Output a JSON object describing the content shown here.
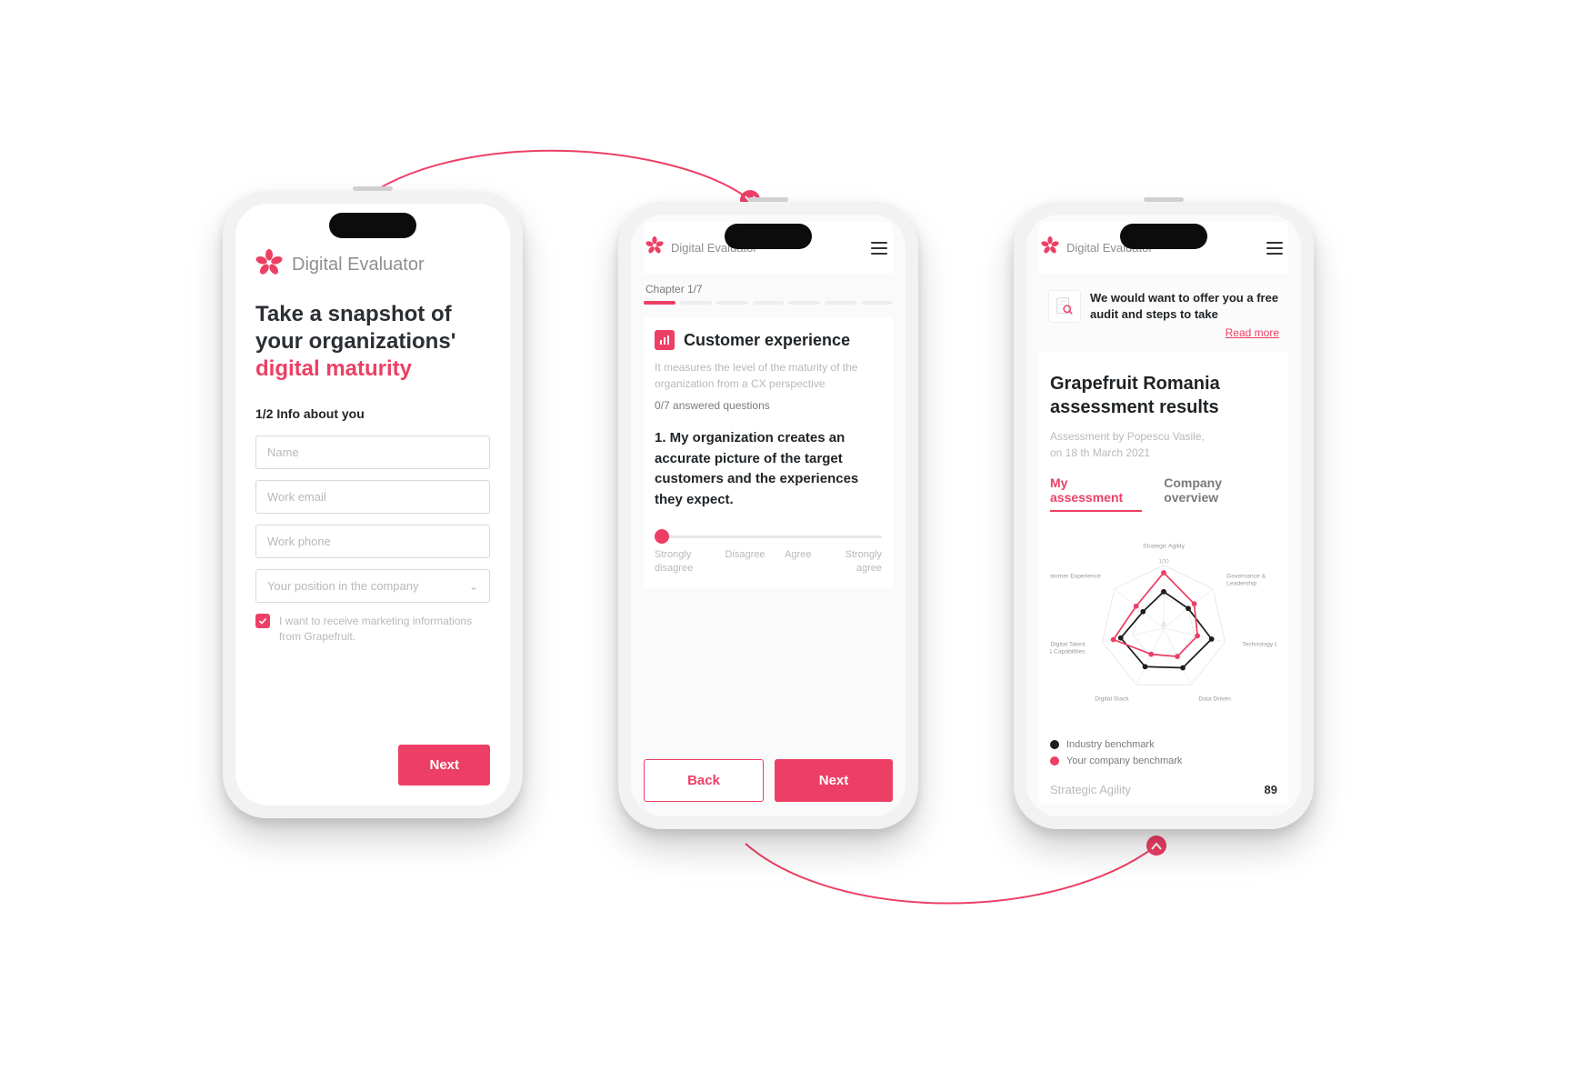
{
  "brand_name": "Digital Evaluator",
  "phone1": {
    "headline_a": "Take a snapshot of your organizations' ",
    "headline_b": "digital maturity",
    "step": "1/2 Info about you",
    "fields": {
      "name": "Name",
      "email": "Work email",
      "phone": "Work phone",
      "position": "Your position in the company"
    },
    "optin": "I want to receive marketing informations from Grapefruit.",
    "next": "Next"
  },
  "phone2": {
    "chapter_label": "Chapter 1/7",
    "title": "Customer experience",
    "desc": "It measures the level of the maturity of the organization from a CX perspective",
    "answered": "0/7 answered questions",
    "question": "1. My organization creates an accurate picture of the target customers and the experiences they expect.",
    "scale": [
      "Strongly disagree",
      "Disagree",
      "Agree",
      "Strongly agree"
    ],
    "back": "Back",
    "next": "Next"
  },
  "phone3": {
    "banner_text": "We would want to offer you a free audit and steps to take",
    "banner_link": "Read more",
    "title": "Grapefruit Romania assessment results",
    "byline1": "Assessment by Popescu Vasile,",
    "byline2": "on 18 th March 2021",
    "tab1": "My assessment",
    "tab2": "Company overview",
    "legend1": "Industry benchmark",
    "legend2": "Your company benchmark",
    "metric_name": "Strategic Agility",
    "metric_val": "89"
  },
  "chart_data": {
    "type": "radar",
    "title": "",
    "axes": [
      "Strategic Agility",
      "Governance & Leadership",
      "Technology Leadership",
      "Data Driven",
      "Digital Stack",
      "Digital Talent & Capabilities",
      "Customer Experience"
    ],
    "ticks": [
      0,
      50,
      100
    ],
    "series": [
      {
        "name": "Industry benchmark",
        "color": "#1e1e1e",
        "values": [
          58,
          50,
          78,
          70,
          68,
          70,
          42
        ]
      },
      {
        "name": "Your company benchmark",
        "color": "#ed3f65",
        "values": [
          88,
          62,
          55,
          50,
          46,
          82,
          56
        ]
      }
    ]
  }
}
